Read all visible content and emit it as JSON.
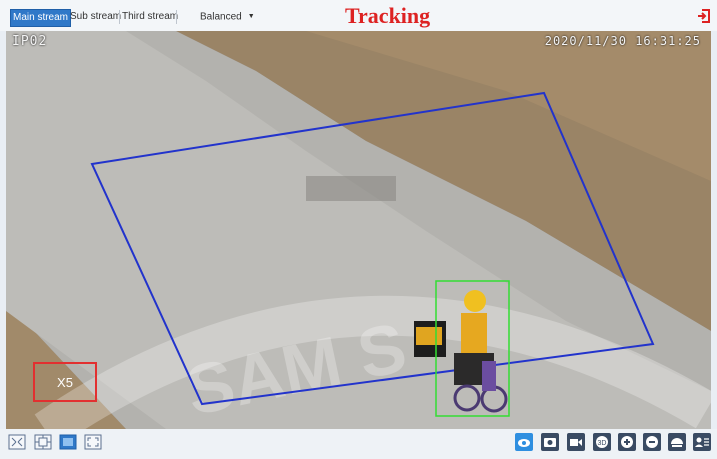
{
  "header": {
    "streams": [
      {
        "label": "Main stream",
        "active": true
      },
      {
        "label": "Sub stream",
        "active": false
      },
      {
        "label": "Third stream",
        "active": false
      }
    ],
    "quality": "Balanced",
    "title": "Tracking"
  },
  "video": {
    "camera_name": "IP02",
    "timestamp": "2020/11/30 16:31:25",
    "zoom_label": "X5",
    "colors": {
      "tracking_zone": "#2233cc",
      "target_box": "#33dd33",
      "zoom_box": "#e23030"
    }
  },
  "toolbar": {
    "left_icons": [
      "fit-window-icon",
      "original-size-icon",
      "stretch-icon",
      "fullscreen-icon"
    ],
    "right_icons": [
      "view-eye-icon",
      "snapshot-icon",
      "record-icon",
      "3d-zoom-icon",
      "zoom-in-icon",
      "zoom-out-icon",
      "ptz-icon",
      "user-track-icon"
    ]
  }
}
